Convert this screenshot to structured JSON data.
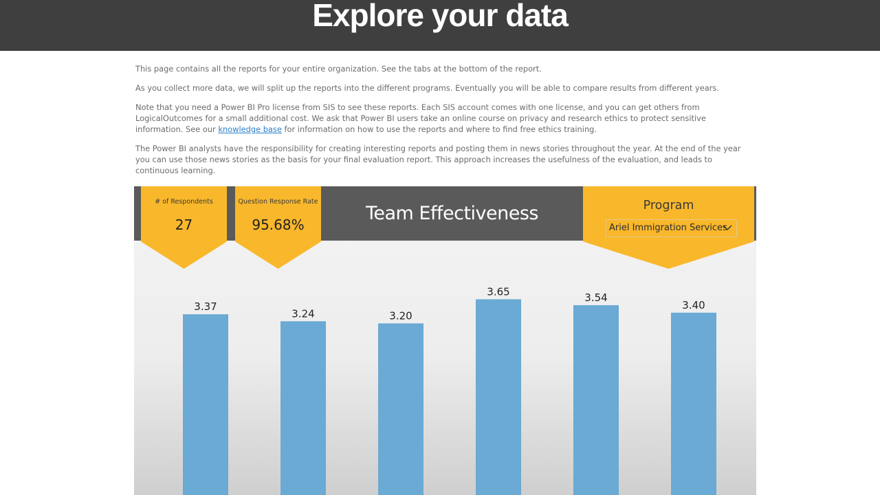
{
  "page": {
    "title": "Explore your data",
    "paragraphs": {
      "p1": "This page contains all the reports for your entire organization. See the tabs at the bottom of the report.",
      "p2": "As you collect more data, we will split up the reports into the different programs. Eventually you will be able to compare results from different years.",
      "p3_before": "Note that you need a Power BI Pro license from SIS to see these reports. Each SIS account comes with one license, and you can get others from LogicalOutcomes for a small additional cost. We ask that Power BI users take an online course on privacy and research ethics to protect sensitive information. See our ",
      "p3_link": "knowledge base",
      "p3_after": " for information on how to use the reports and where to find free ethics training.",
      "p4": "The Power BI analysts have the responsibility for creating interesting reports and posting them in news stories throughout the year. At the end of the year you can use those news stories as the basis for your final evaluation report. This approach increases the usefulness of the evaluation, and leads to continuous learning."
    }
  },
  "report": {
    "title": "Team Effectiveness",
    "kpis": [
      {
        "label": "# of Respondents",
        "value": "27"
      },
      {
        "label": "Question Response Rate",
        "value": "95.68%"
      }
    ],
    "program": {
      "label": "Program",
      "selected": "Ariel Immigration Services",
      "icon": "chevron-down-icon"
    }
  },
  "colors": {
    "header_bg": "#3f3f3f",
    "accent": "#f9b72b",
    "bar": "#6aaad4",
    "link": "#2a7fc9"
  },
  "chart_data": {
    "type": "bar",
    "values": [
      3.37,
      3.24,
      3.2,
      3.65,
      3.54,
      3.4
    ],
    "labels": [
      "3.37",
      "3.24",
      "3.20",
      "3.65",
      "3.54",
      "3.40"
    ],
    "ylim": [
      0,
      3.85
    ],
    "grid": false
  }
}
